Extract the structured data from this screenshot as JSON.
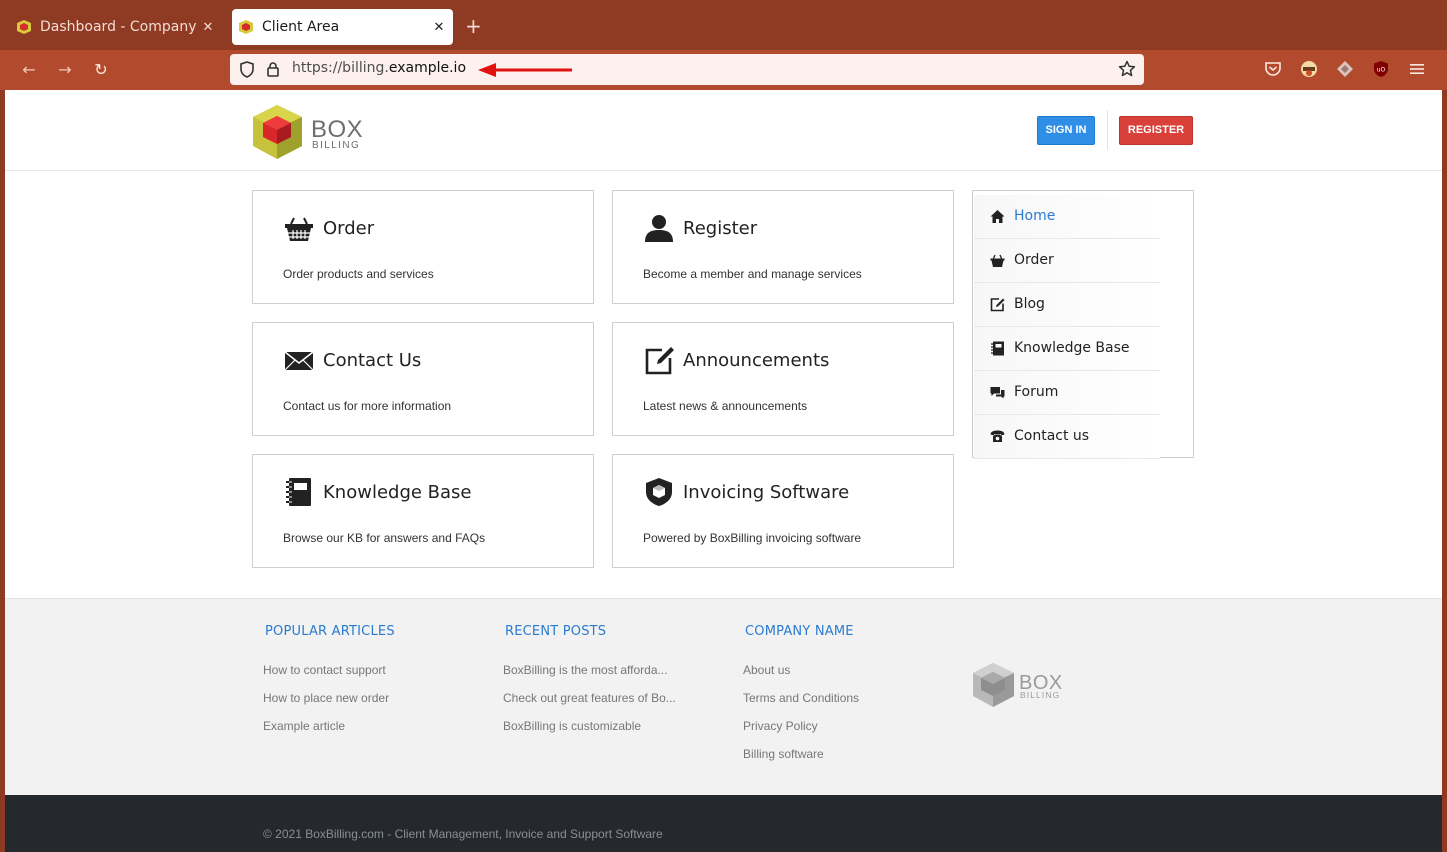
{
  "browser": {
    "tabs": [
      {
        "title": "Dashboard - Company Name",
        "active": false
      },
      {
        "title": "Client Area",
        "active": true
      }
    ],
    "new_tab": "+",
    "url_prefix": "https://billing.",
    "url_domain": "example.io",
    "colors": {
      "tabbar": "#8f3a22",
      "navbar": "#b24b2d"
    }
  },
  "header": {
    "logo_line1": "BOX",
    "logo_line2": "BILLING",
    "sign_in": "SIGN IN",
    "register": "REGISTER"
  },
  "cards": [
    {
      "title": "Order",
      "desc": "Order products and services",
      "icon": "basket-icon"
    },
    {
      "title": "Register",
      "desc": "Become a member and manage services",
      "icon": "user-icon"
    },
    {
      "title": "Contact Us",
      "desc": "Contact us for more information",
      "icon": "envelope-icon"
    },
    {
      "title": "Announcements",
      "desc": "Latest news & announcements",
      "icon": "edit-icon"
    },
    {
      "title": "Knowledge Base",
      "desc": "Browse our KB for answers and FAQs",
      "icon": "book-icon"
    },
    {
      "title": "Invoicing Software",
      "desc": "Powered by BoxBilling invoicing software",
      "icon": "shield-icon"
    }
  ],
  "side_menu": [
    {
      "label": "Home",
      "icon": "home-icon",
      "active": true
    },
    {
      "label": "Order",
      "icon": "basket-icon",
      "active": false
    },
    {
      "label": "Blog",
      "icon": "edit-icon",
      "active": false
    },
    {
      "label": "Knowledge Base",
      "icon": "book-icon",
      "active": false
    },
    {
      "label": "Forum",
      "icon": "chat-icon",
      "active": false
    },
    {
      "label": "Contact us",
      "icon": "phone-icon",
      "active": false
    }
  ],
  "footer": {
    "popular": {
      "title": "POPULAR ARTICLES",
      "links": [
        "How to contact support",
        "How to place new order",
        "Example article"
      ]
    },
    "recent": {
      "title": "RECENT POSTS",
      "links": [
        "BoxBilling is the most afforda...",
        "Check out great features of Bo...",
        "BoxBilling is customizable"
      ]
    },
    "company": {
      "title": "COMPANY NAME",
      "links": [
        "About us",
        "Terms and Conditions",
        "Privacy Policy",
        "Billing software"
      ]
    },
    "logo_line1": "BOX",
    "logo_line2": "BILLING",
    "copyright": "© 2021 BoxBilling.com - Client Management, Invoice and Support Software"
  }
}
